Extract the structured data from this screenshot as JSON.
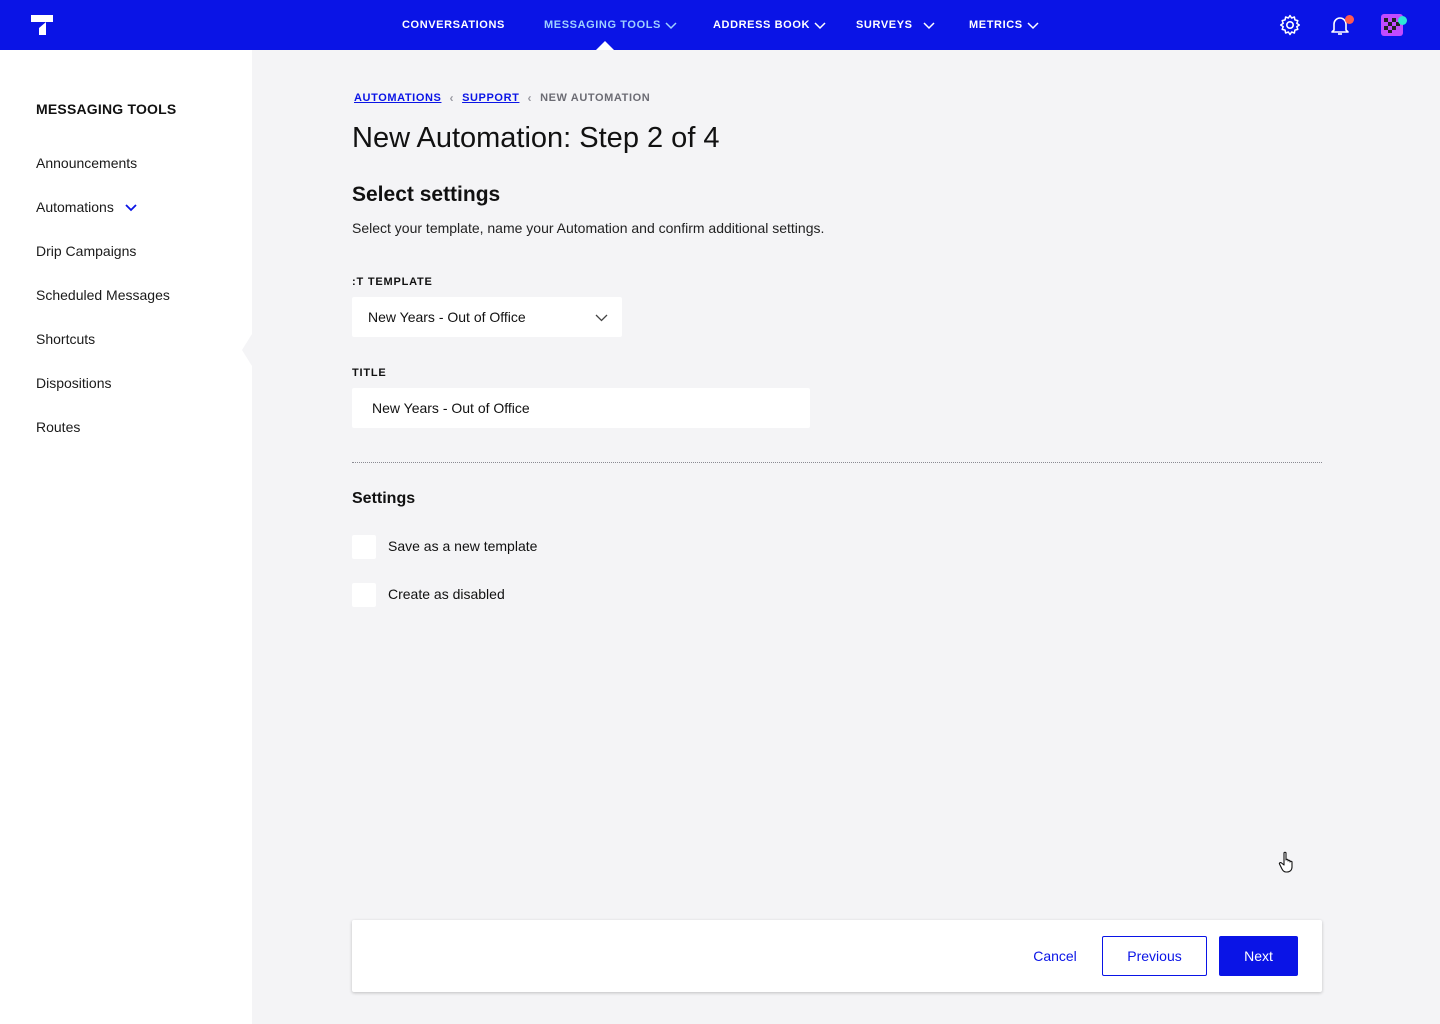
{
  "nav": {
    "items": [
      {
        "label": "CONVERSATIONS"
      },
      {
        "label": "MESSAGING TOOLS"
      },
      {
        "label": "ADDRESS BOOK"
      },
      {
        "label": "SURVEYS"
      },
      {
        "label": "METRICS"
      }
    ],
    "icons": [
      "gear-icon",
      "bell-icon",
      "avatar"
    ],
    "colors": {
      "bar": "#0a14e6",
      "active": "#9fd0ff",
      "notification_dot": "#ff5a4e",
      "avatar_dot": "#2ee6d6"
    }
  },
  "sidebar": {
    "title": "MESSAGING TOOLS",
    "items": [
      {
        "label": "Announcements"
      },
      {
        "label": "Automations"
      },
      {
        "label": "Drip Campaigns"
      },
      {
        "label": "Scheduled Messages"
      },
      {
        "label": "Shortcuts"
      },
      {
        "label": "Dispositions"
      },
      {
        "label": "Routes"
      }
    ]
  },
  "breadcrumb": {
    "items": [
      {
        "label": "AUTOMATIONS"
      },
      {
        "label": "SUPPORT"
      },
      {
        "label": "NEW AUTOMATION"
      }
    ]
  },
  "page": {
    "title": "New Automation: Step 2 of 4",
    "section_title": "Select settings",
    "section_desc": "Select your template, name your Automation and confirm additional settings."
  },
  "form": {
    "template_label": ":T TEMPLATE",
    "template_value": "New Years - Out of Office",
    "title_label": "TITLE",
    "title_value": "New Years - Out of Office"
  },
  "settings": {
    "title": "Settings",
    "options": [
      {
        "label": "Save as a new template"
      },
      {
        "label": "Create as disabled"
      }
    ]
  },
  "footer": {
    "cancel": "Cancel",
    "previous": "Previous",
    "next": "Next"
  }
}
